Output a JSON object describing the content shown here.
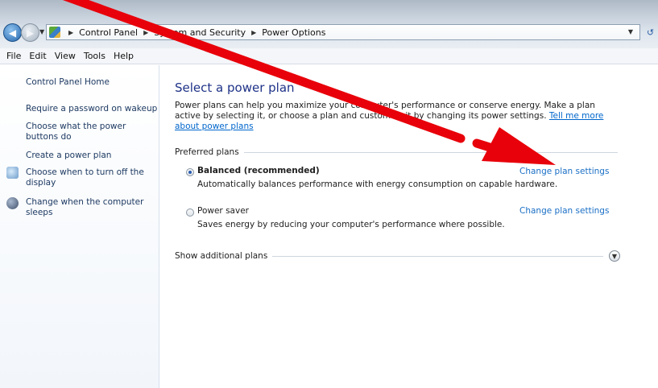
{
  "window": {
    "breadcrumb": [
      "Control Panel",
      "System and Security",
      "Power Options"
    ]
  },
  "menubar": {
    "items": [
      "File",
      "Edit",
      "View",
      "Tools",
      "Help"
    ]
  },
  "sidebar": {
    "home": "Control Panel Home",
    "links": [
      "Require a password on wakeup",
      "Choose what the power buttons do",
      "Create a power plan",
      "Choose when to turn off the display",
      "Change when the computer sleeps"
    ],
    "icons": {
      "display": "monitor-icon",
      "sleep": "moon-icon"
    }
  },
  "main": {
    "title": "Select a power plan",
    "description": "Power plans can help you maximize your computer's performance or conserve energy. Make a plan active by selecting it, or choose a plan and customize it by changing its power settings.",
    "learn_more": "Tell me more about power plans",
    "preferred_label": "Preferred plans",
    "plans": [
      {
        "name": "Balanced (recommended)",
        "selected": true,
        "description": "Automatically balances performance with energy consumption on capable hardware.",
        "link": "Change plan settings"
      },
      {
        "name": "Power saver",
        "selected": false,
        "description": "Saves energy by reducing your computer's performance where possible.",
        "link": "Change plan settings"
      }
    ],
    "additional_label": "Show additional plans"
  },
  "colors": {
    "title": "#1e3287",
    "link": "#1a6fc6",
    "annotation_arrow": "#e8000a"
  }
}
